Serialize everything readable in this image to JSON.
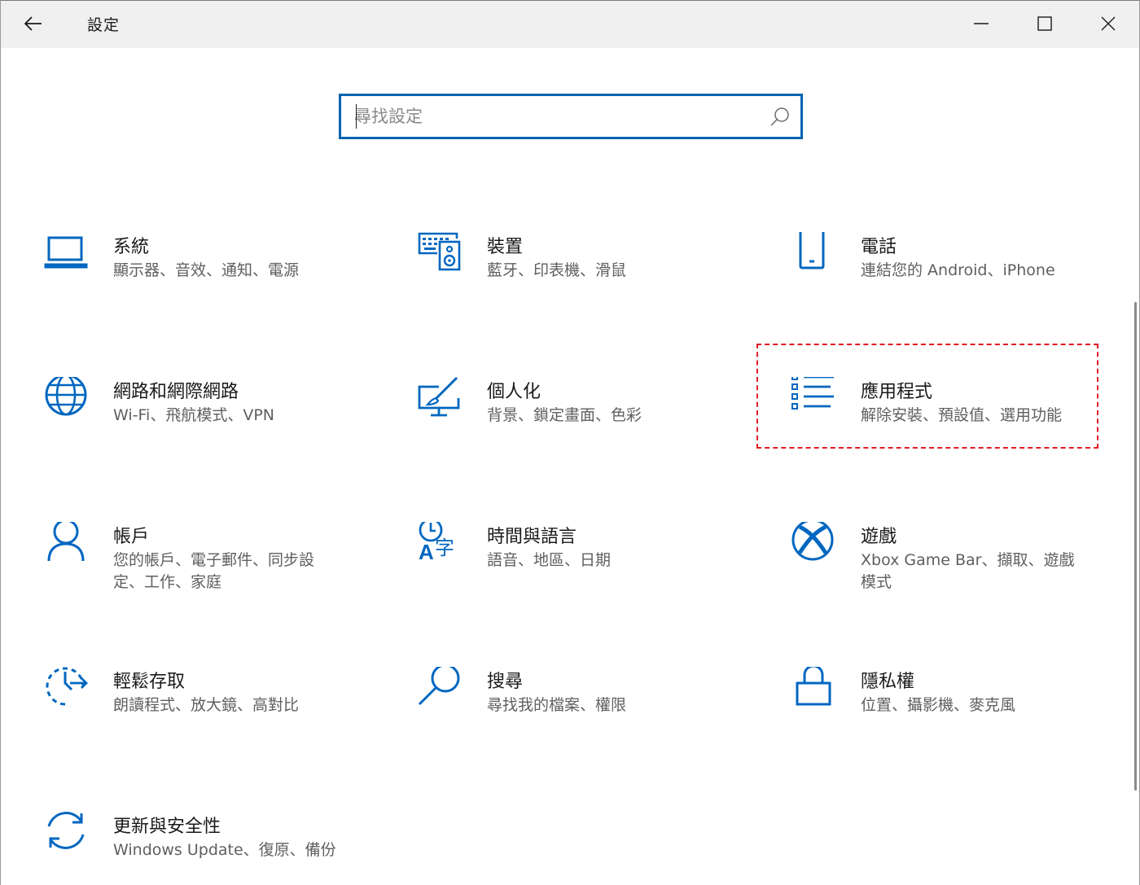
{
  "window": {
    "title": "設定",
    "controls": {
      "minimize_icon": "minimize-icon",
      "maximize_icon": "maximize-icon",
      "close_icon": "close-icon"
    },
    "back_icon": "back-arrow-icon"
  },
  "search": {
    "placeholder": "尋找設定",
    "value": "",
    "icon": "search-icon"
  },
  "tiles": [
    {
      "id": "system",
      "icon": "laptop-icon",
      "title": "系統",
      "desc": "顯示器、音效、通知、電源"
    },
    {
      "id": "devices",
      "icon": "keyboard-speaker-icon",
      "title": "裝置",
      "desc": "藍牙、印表機、滑鼠"
    },
    {
      "id": "phone",
      "icon": "phone-icon",
      "title": "電話",
      "desc": "連結您的 Android、iPhone"
    },
    {
      "id": "network",
      "icon": "globe-icon",
      "title": "網路和網際網路",
      "desc": "Wi-Fi、飛航模式、VPN"
    },
    {
      "id": "personalization",
      "icon": "paint-monitor-icon",
      "title": "個人化",
      "desc": "背景、鎖定畫面、色彩"
    },
    {
      "id": "apps",
      "icon": "app-list-icon",
      "title": "應用程式",
      "desc": "解除安裝、預設值、選用功能"
    },
    {
      "id": "accounts",
      "icon": "person-icon",
      "title": "帳戶",
      "desc": "您的帳戶、電子郵件、同步設定、工作、家庭"
    },
    {
      "id": "time-language",
      "icon": "time-language-icon",
      "title": "時間與語言",
      "desc": "語音、地區、日期"
    },
    {
      "id": "gaming",
      "icon": "xbox-icon",
      "title": "遊戲",
      "desc": "Xbox Game Bar、擷取、遊戲模式"
    },
    {
      "id": "ease-of-access",
      "icon": "ease-of-access-icon",
      "title": "輕鬆存取",
      "desc": "朗讀程式、放大鏡、高對比"
    },
    {
      "id": "search",
      "icon": "magnifier-icon",
      "title": "搜尋",
      "desc": "尋找我的檔案、權限"
    },
    {
      "id": "privacy",
      "icon": "lock-icon",
      "title": "隱私權",
      "desc": "位置、攝影機、麥克風"
    },
    {
      "id": "update-security",
      "icon": "sync-icon",
      "title": "更新與安全性",
      "desc": "Windows Update、復原、備份"
    }
  ],
  "highlighted_tile": "apps",
  "colors": {
    "accent": "#0067c0",
    "highlight_border": "#e31b23",
    "titlebar": "#f0f0f0"
  }
}
